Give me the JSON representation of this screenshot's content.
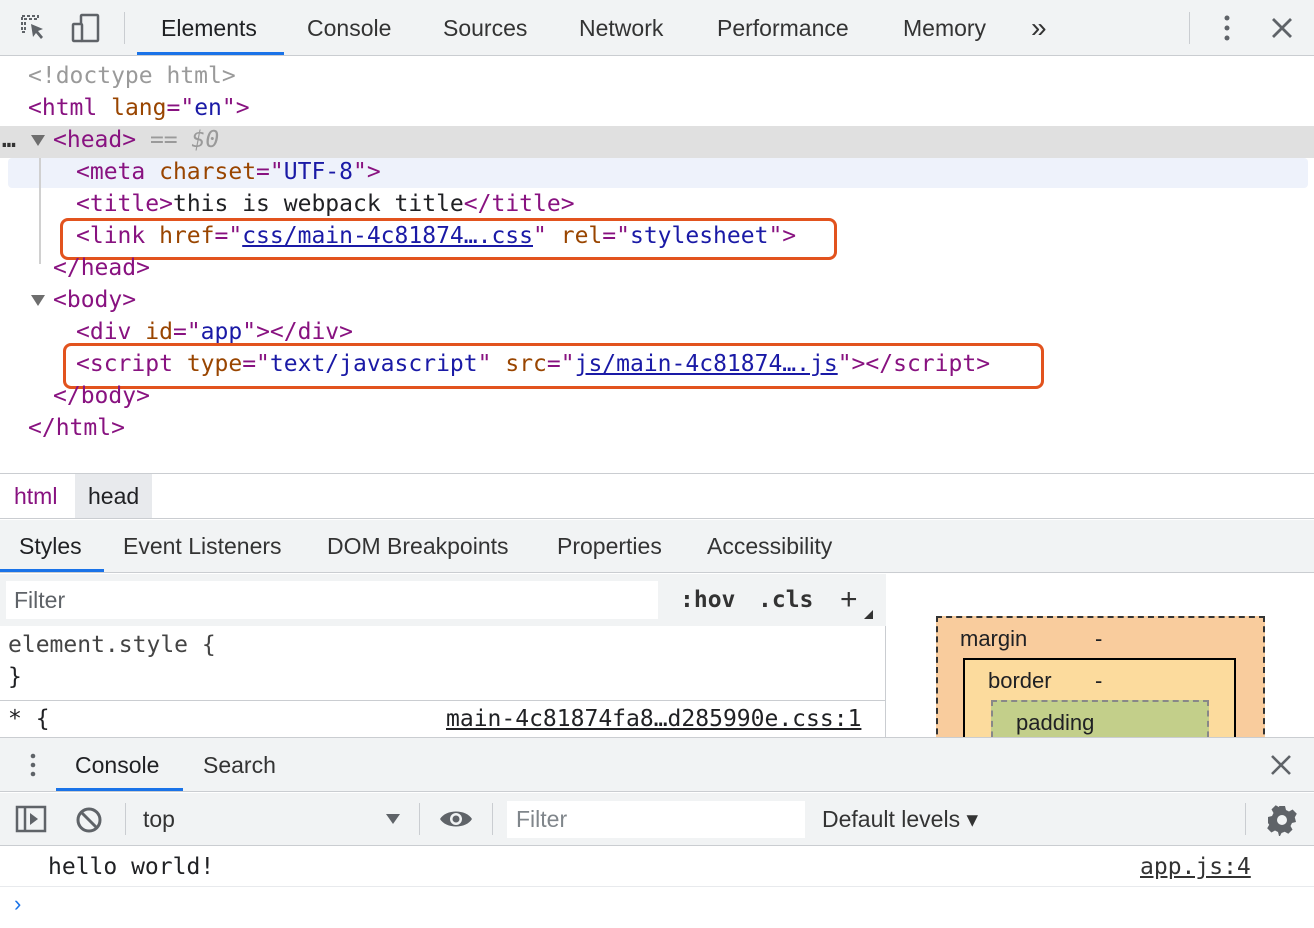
{
  "toolbar": {
    "tabs": [
      "Elements",
      "Console",
      "Sources",
      "Network",
      "Performance",
      "Memory"
    ],
    "more": "»",
    "colors": {
      "active_tab_underline": "#1a73e8"
    }
  },
  "elements": {
    "doctype": "<!doctype html>",
    "html_open": {
      "tag": "html",
      "attr": "lang",
      "value": "en"
    },
    "head": {
      "tag": "head",
      "suffix": " == $0",
      "ellipsis": "…"
    },
    "meta": {
      "tag": "meta",
      "attr": "charset",
      "value": "UTF-8"
    },
    "title": {
      "tag": "title",
      "text": "this is webpack title"
    },
    "link": {
      "tag": "link",
      "attr1": "href",
      "value1": "css/main-4c81874….css",
      "attr2": "rel",
      "value2": "stylesheet"
    },
    "head_close": "</head>",
    "body_open": "body",
    "div": {
      "tag": "div",
      "attr": "id",
      "value": "app"
    },
    "script": {
      "tag": "script",
      "attr1": "type",
      "value1": "text/javascript",
      "attr2": "src",
      "value2": "js/main-4c81874….js"
    },
    "body_close": "</body>",
    "html_close": "</html>",
    "highlight_color": "#e2531e"
  },
  "breadcrumb": [
    "html",
    "head"
  ],
  "subtabs": [
    "Styles",
    "Event Listeners",
    "DOM Breakpoints",
    "Properties",
    "Accessibility"
  ],
  "styles": {
    "filter_placeholder": "Filter",
    "hov": ":hov",
    "cls": ".cls",
    "add": "+",
    "rule1_selector": "element.style {",
    "rule1_close": "}",
    "rule2_selector": "* {",
    "rule2_source": "main-4c81874fa8…d285990e.css:1"
  },
  "boxmodel": {
    "margin": "margin",
    "margin_val": "-",
    "border": "border",
    "border_val": "-",
    "padding": "padding"
  },
  "drawer": {
    "tabs": [
      "Console",
      "Search"
    ],
    "context": "top",
    "filter_placeholder": "Filter",
    "levels": "Default levels ▾",
    "message": "hello world!",
    "message_source": "app.js:4",
    "prompt": "›"
  }
}
